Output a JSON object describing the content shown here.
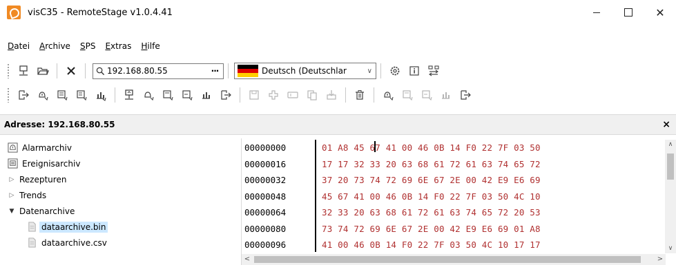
{
  "window": {
    "title": "visC35 - RemoteStage v1.0.4.41",
    "minimize_label": "—",
    "maximize_label": "☐",
    "close_label": "✕"
  },
  "menu": {
    "items": [
      {
        "key": "D",
        "rest": "atei"
      },
      {
        "key": "A",
        "rest": "rchive"
      },
      {
        "key": "S",
        "rest": "PS"
      },
      {
        "key": "E",
        "rest": "xtras"
      },
      {
        "key": "H",
        "rest": "ilfe"
      }
    ]
  },
  "toolbar": {
    "address_value": "192.168.80.55",
    "browse_label": "···",
    "language_value": "Deutsch (Deutschlar",
    "flag_colors": [
      "#000000",
      "#dd0000",
      "#ffce00"
    ]
  },
  "address_header": {
    "label": "Adresse: 192.168.80.55",
    "close_label": "×"
  },
  "tree": {
    "items": [
      {
        "label": "Alarmarchiv",
        "icon": "alarm-archive-icon"
      },
      {
        "label": "Ereignisarchiv",
        "icon": "event-archive-icon"
      },
      {
        "label": "Rezepturen",
        "icon": "expand-arrow-icon"
      },
      {
        "label": "Trends",
        "icon": "expand-arrow-icon"
      },
      {
        "label": "Datenarchive",
        "icon": "collapse-arrow-icon"
      },
      {
        "label": "dataarchive.bin",
        "icon": "file-icon"
      },
      {
        "label": "dataarchive.csv",
        "icon": "file-icon"
      }
    ]
  },
  "hex": {
    "rows": [
      {
        "offset": "00000000",
        "bytes": "01 A8 45 67 41 00 46 0B 14 F0 22 7F 03 50"
      },
      {
        "offset": "00000016",
        "bytes": "17 17 32 33 20 63 68 61 72 61 63 74 65 72"
      },
      {
        "offset": "00000032",
        "bytes": "37 20 73 74 72 69 6E 67 2E 00 42 E9 E6 69"
      },
      {
        "offset": "00000048",
        "bytes": "45 67 41 00 46 0B 14 F0 22 7F 03 50 4C 10"
      },
      {
        "offset": "00000064",
        "bytes": "32 33 20 63 68 61 72 61 63 74 65 72 20 53"
      },
      {
        "offset": "00000080",
        "bytes": "73 74 72 69 6E 67 2E 00 42 E9 E6 69 01 A8"
      },
      {
        "offset": "00000096",
        "bytes": "41 00 46 0B 14 F0 22 7F 03 50 4C 10 17 17"
      }
    ]
  }
}
